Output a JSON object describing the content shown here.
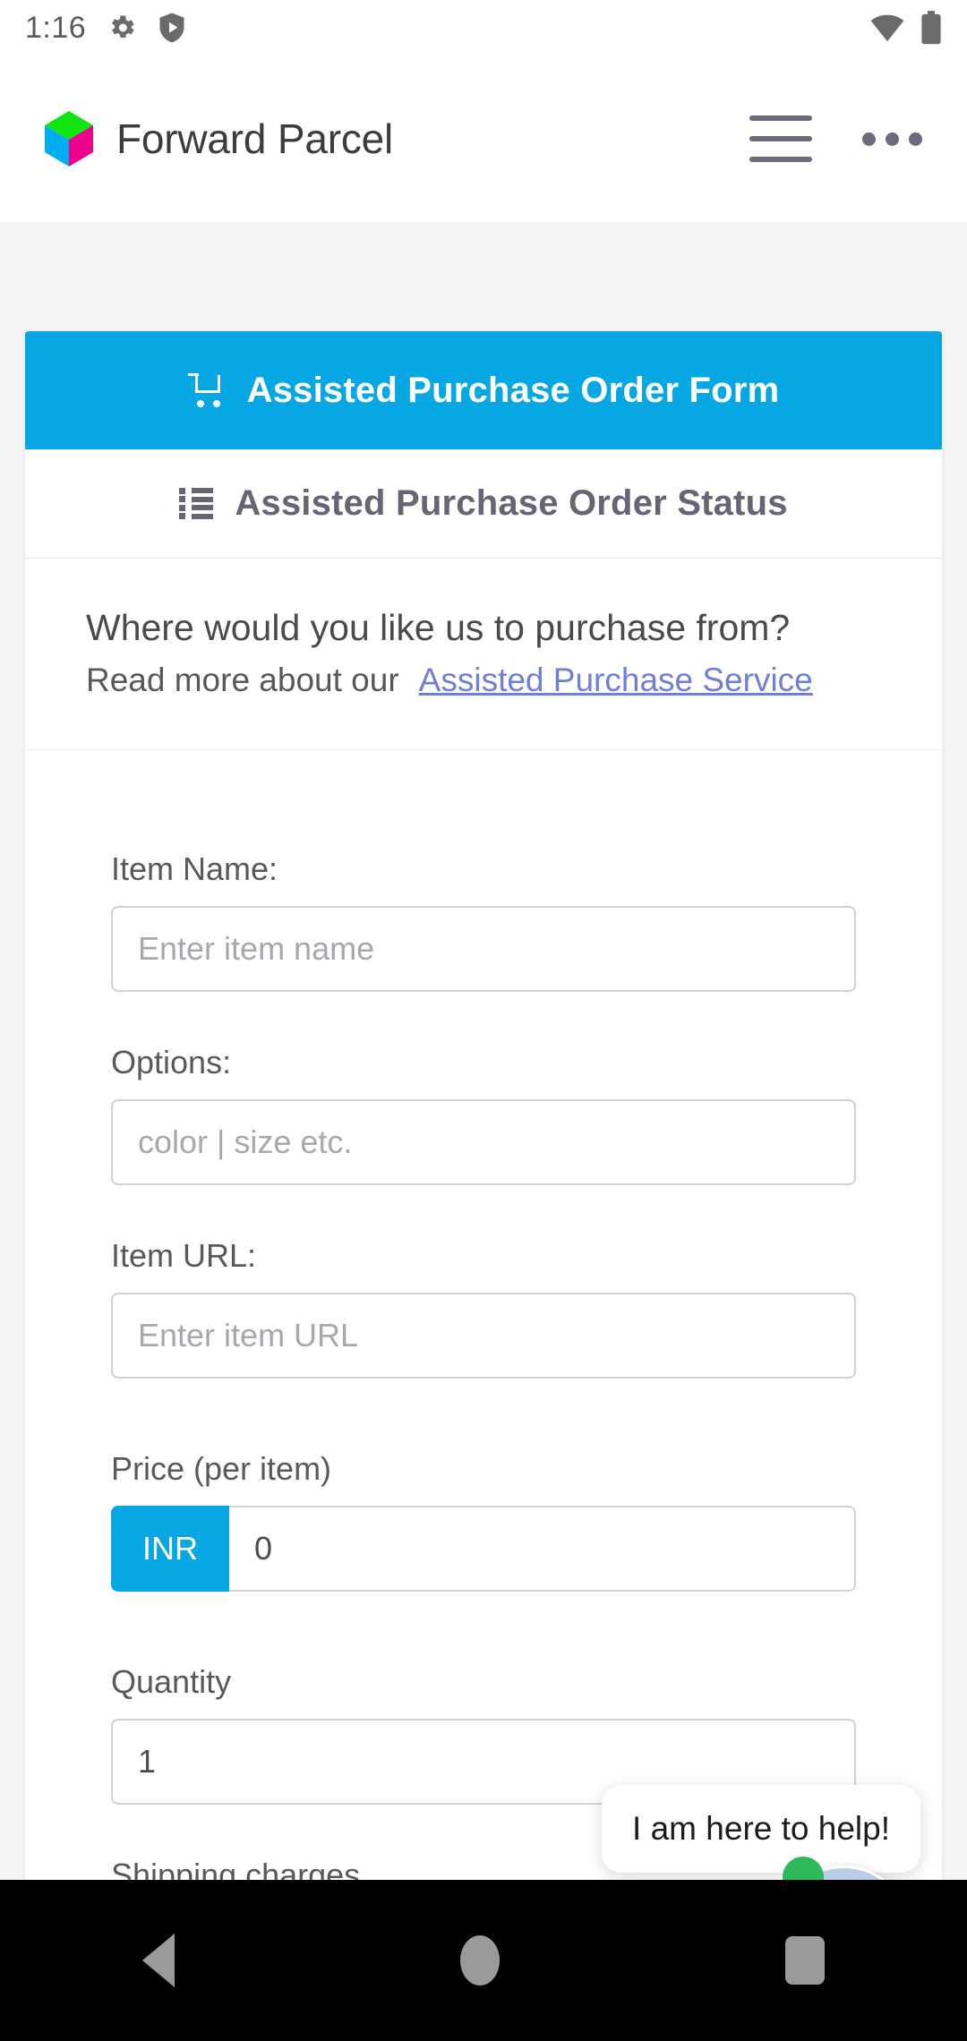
{
  "status_bar": {
    "time": "1:16",
    "left_icons": [
      "gear-icon",
      "shield-play-icon"
    ],
    "right_icons": [
      "wifi-icon",
      "battery-icon"
    ]
  },
  "app_bar": {
    "brand_name": "Forward Parcel",
    "logo_icon": "cube-logo",
    "logo_colors": {
      "top": "#12e612",
      "left": "#00aeef",
      "right": "#ec008c"
    },
    "menu_icon": "hamburger-menu-icon",
    "overflow_icon": "more-options-icon"
  },
  "tabs": [
    {
      "label": "Assisted Purchase Order Form",
      "icon": "shopping-cart-icon",
      "active": true
    },
    {
      "label": "Assisted Purchase Order Status",
      "icon": "list-icon",
      "active": false
    }
  ],
  "intro": {
    "title": "Where would you like us to purchase from?",
    "read_more_prefix": "Read more about our",
    "link_text": "Assisted Purchase Service",
    "link_color": "#6f7fd8"
  },
  "form": {
    "item_name": {
      "label": "Item Name:",
      "placeholder": "Enter item name",
      "value": ""
    },
    "options": {
      "label": "Options:",
      "placeholder": "color | size etc.",
      "value": ""
    },
    "item_url": {
      "label": "Item URL:",
      "placeholder": "Enter item URL",
      "value": ""
    },
    "price": {
      "label": "Price (per item)",
      "currency": "INR",
      "value": "0"
    },
    "quantity": {
      "label": "Quantity",
      "value": "1"
    },
    "shipping_charges": {
      "label": "Shipping charges"
    }
  },
  "chat": {
    "message": "I am here to help!",
    "avatar_icon": "support-agent-avatar",
    "online_indicator_color": "#2eb85c"
  },
  "nav_bar": {
    "back_icon": "back-triangle-icon",
    "home_icon": "home-circle-icon",
    "recents_icon": "recents-square-icon"
  },
  "theme": {
    "accent": "#06a7e2",
    "text": "#4a4a4a"
  }
}
